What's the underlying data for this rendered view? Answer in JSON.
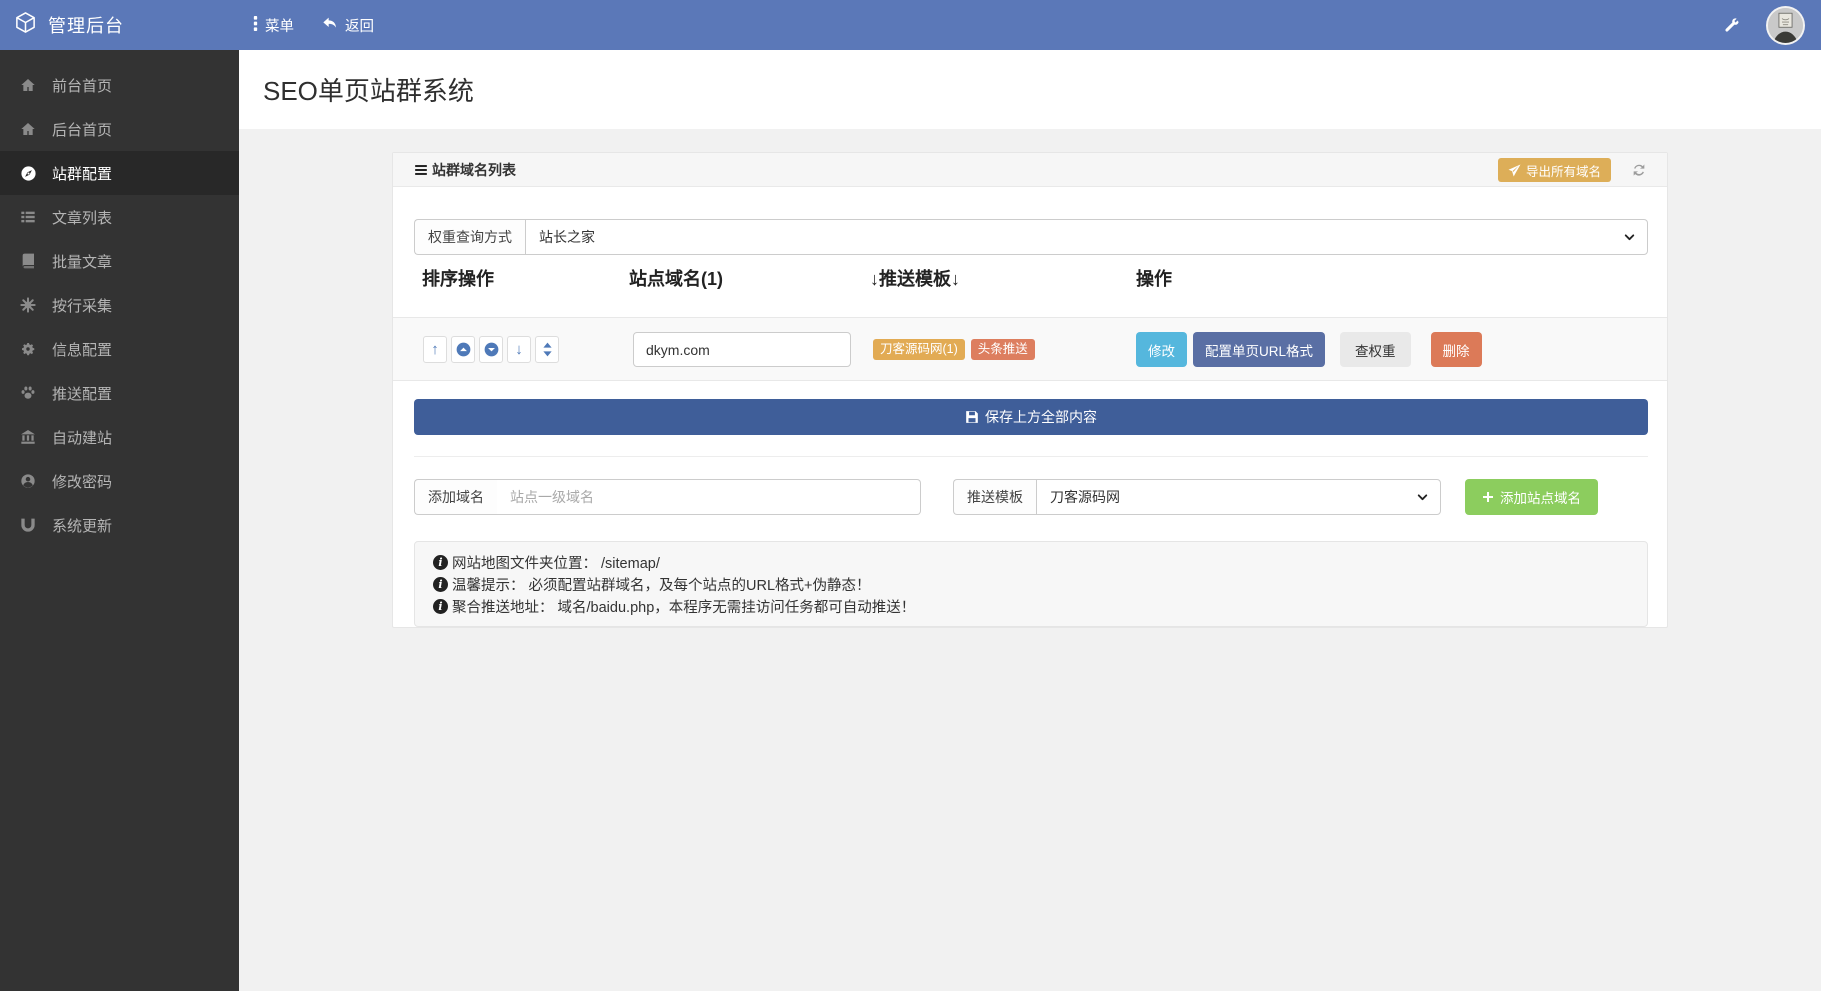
{
  "navbar": {
    "brand": "管理后台",
    "menu": "菜单",
    "back": "返回"
  },
  "sidebar": {
    "items": [
      {
        "label": "前台首页",
        "icon": "home-icon"
      },
      {
        "label": "后台首页",
        "icon": "home-icon"
      },
      {
        "label": "站群配置",
        "icon": "compass-icon",
        "active": true
      },
      {
        "label": "文章列表",
        "icon": "list-icon"
      },
      {
        "label": "批量文章",
        "icon": "book-icon"
      },
      {
        "label": "按行采集",
        "icon": "burst-icon"
      },
      {
        "label": "信息配置",
        "icon": "gear-icon"
      },
      {
        "label": "推送配置",
        "icon": "paw-icon"
      },
      {
        "label": "自动建站",
        "icon": "bank-icon"
      },
      {
        "label": "修改密码",
        "icon": "user-circle-icon"
      },
      {
        "label": "系统更新",
        "icon": "magnet-icon"
      }
    ]
  },
  "page": {
    "title": "SEO单页站群系统"
  },
  "panel": {
    "heading": "站群域名列表",
    "export_label": "导出所有域名",
    "weight_query_label": "权重查询方式",
    "weight_query_value": "站长之家",
    "columns": [
      "排序操作",
      "站点域名(1)",
      "↓推送模板↓",
      "操作"
    ],
    "row": {
      "domain": "dkym.com",
      "badge_template": "刀客源码网(1)",
      "badge_push": "头条推送",
      "action_edit": "修改",
      "action_config": "配置单页URL格式",
      "action_weight": "查权重",
      "action_delete": "删除"
    },
    "save_label": "保存上方全部内容",
    "add_domain_label": "添加域名",
    "add_domain_placeholder": "站点一级域名",
    "push_template_label": "推送模板",
    "push_template_value": "刀客源码网",
    "add_site_label": "添加站点域名",
    "notes": [
      "网站地图文件夹位置： /sitemap/",
      "温馨提示： 必须配置站群域名，及每个站点的URL格式+伪静态！",
      "聚合推送地址： 域名/baidu.php，本程序无需挂访问任务都可自动推送！"
    ]
  },
  "colors": {
    "navbar": "#5b78b8",
    "sidebar": "#333333",
    "save_button": "#3f5e99",
    "primary_button": "#5a6fa4",
    "info_button": "#55b7dd",
    "danger_button": "#dc7a58",
    "warning_badge": "#e2ab54",
    "push_badge": "#dd7e5f",
    "export_button": "#ddae58",
    "add_button": "#8ccd5e",
    "sort_icon_blue": "#4e79b8"
  }
}
